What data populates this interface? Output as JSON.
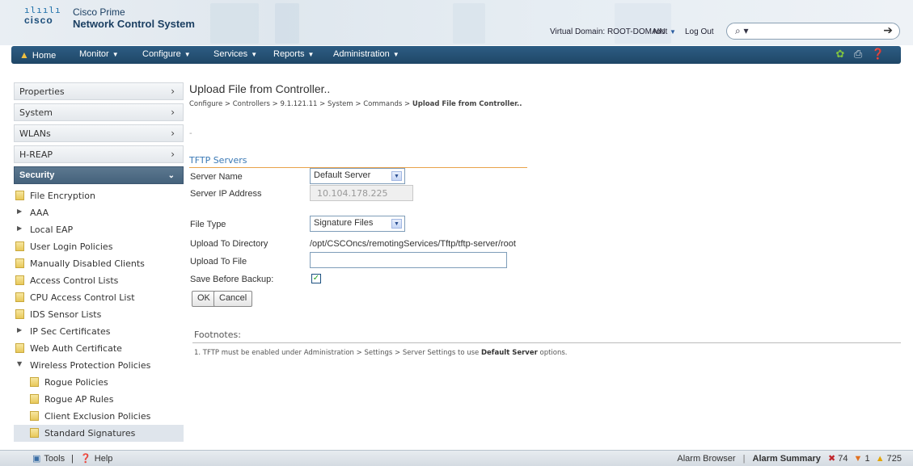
{
  "header": {
    "logo_bars": "ılıılı",
    "logo_text": "cisco",
    "product_line1": "Cisco Prime",
    "product_line2": "Network Control System",
    "virtual_domain": "Virtual Domain: ROOT-DOMAIN",
    "user": "root",
    "logout": "Log Out",
    "search_placeholder": ""
  },
  "nav": {
    "home": "Home",
    "monitor": "Monitor",
    "configure": "Configure",
    "services": "Services",
    "reports": "Reports",
    "administration": "Administration"
  },
  "sidebar": {
    "categories": [
      {
        "label": "Properties"
      },
      {
        "label": "System"
      },
      {
        "label": "WLANs"
      },
      {
        "label": "H-REAP"
      },
      {
        "label": "Security"
      }
    ],
    "items": [
      {
        "label": "File Encryption"
      },
      {
        "label": "AAA"
      },
      {
        "label": "Local EAP"
      },
      {
        "label": "User Login Policies"
      },
      {
        "label": "Manually Disabled Clients"
      },
      {
        "label": "Access Control Lists"
      },
      {
        "label": "CPU Access Control List"
      },
      {
        "label": "IDS Sensor Lists"
      },
      {
        "label": "IP Sec Certificates"
      },
      {
        "label": "Web Auth Certificate"
      },
      {
        "label": "Wireless Protection Policies"
      },
      {
        "label": "Rogue Policies"
      },
      {
        "label": "Rogue AP Rules"
      },
      {
        "label": "Client Exclusion Policies"
      },
      {
        "label": "Standard Signatures"
      }
    ]
  },
  "main": {
    "title": "Upload File from Controller..",
    "breadcrumb": "Configure > Controllers > 9.1.121.11 > System > Commands > ",
    "breadcrumb_current": "Upload File from Controller..",
    "dash": "-",
    "section": "TFTP Servers",
    "server_name_label": "Server Name",
    "server_name_value": "Default Server",
    "server_ip_label": "Server IP Address",
    "server_ip_value": "10.104.178.225",
    "file_type_label": "File Type",
    "file_type_value": "Signature Files",
    "upload_dir_label": "Upload To Directory",
    "upload_dir_value": "/opt/CSCOncs/remotingServices/Tftp/tftp-server/root",
    "upload_file_label": "Upload To File",
    "upload_file_value": "",
    "save_before_backup_label": "Save Before Backup:",
    "ok": "OK",
    "cancel": "Cancel",
    "footnotes_title": "Footnotes:",
    "footnote_text": "1. TFTP must be enabled under Administration > Settings > Server Settings to use ",
    "footnote_bold": "Default Server",
    "footnote_tail": " options."
  },
  "statusbar": {
    "tools": "Tools",
    "sep": "|",
    "help": "Help",
    "alarm_browser": "Alarm Browser",
    "alarm_summary": "Alarm Summary",
    "critical_count": "74",
    "major_count": "1",
    "minor_count": "725"
  }
}
